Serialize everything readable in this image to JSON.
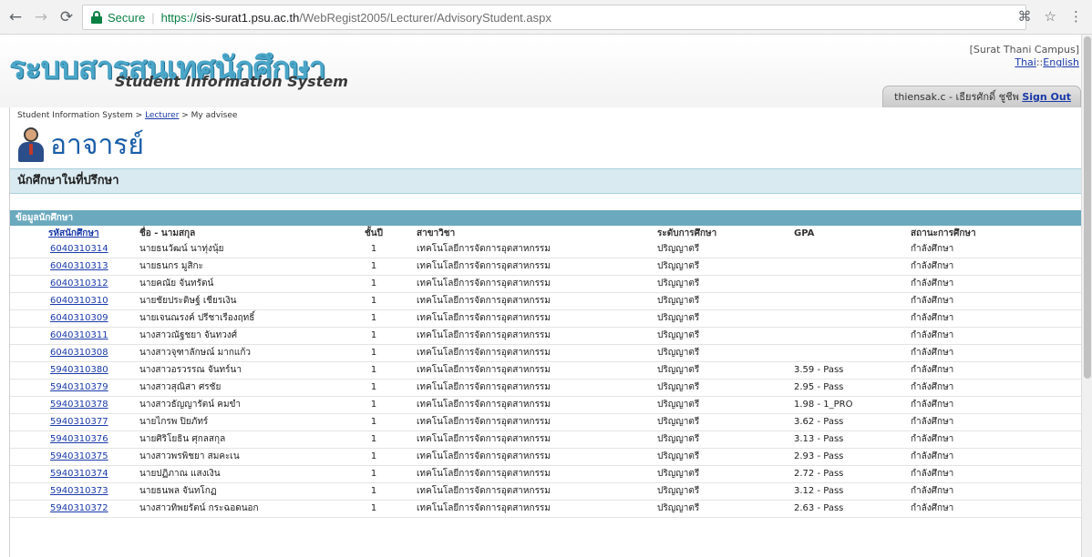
{
  "browser": {
    "secure_label": "Secure",
    "url_scheme": "https://",
    "url_host": "sis-surat1.psu.ac.th",
    "url_path": "/WebRegist2005/Lecturer/AdvisoryStudent.aspx"
  },
  "header": {
    "logo_thai": "ระบบสารสนเทศนักศึกษา",
    "logo_eng": "Student Information System",
    "campus": "[Surat Thani Campus]",
    "lang_thai": "Thai",
    "lang_sep": "::",
    "lang_eng": "English",
    "user": "thiensak.c - เธียรศักดิ์ ชูชีพ",
    "signout": "Sign Out"
  },
  "breadcrumb": {
    "root": "Student Information System",
    "sep1": " > ",
    "lecturer": "Lecturer",
    "sep2": " > ",
    "current": "My advisee"
  },
  "page": {
    "title": "อาจารย์",
    "section": "นักศึกษาในที่ปรึกษา",
    "data_head": "ข้อมูลนักศึกษา"
  },
  "table": {
    "columns": [
      "รหัสนักศึกษา",
      "ชื่อ - นามสกุล",
      "ชั้นปี",
      "สาขาวิชา",
      "ระดับการศึกษา",
      "GPA",
      "สถานะการศึกษา"
    ],
    "rows": [
      [
        "6040310314",
        "นายธนวัฒน์ นาทุ่งนุ้ย",
        "1",
        "เทคโนโลยีการจัดการอุตสาหกรรม",
        "ปริญญาตรี",
        "",
        "กำลังศึกษา"
      ],
      [
        "6040310313",
        "นายธนกร มูสิกะ",
        "1",
        "เทคโนโลยีการจัดการอุตสาหกรรม",
        "ปริญญาตรี",
        "",
        "กำลังศึกษา"
      ],
      [
        "6040310312",
        "นายคณัย จันทรัตน์",
        "1",
        "เทคโนโลยีการจัดการอุตสาหกรรม",
        "ปริญญาตรี",
        "",
        "กำลังศึกษา"
      ],
      [
        "6040310310",
        "นายชัยประดิษฐ์ เชียรเงิน",
        "1",
        "เทคโนโลยีการจัดการอุตสาหกรรม",
        "ปริญญาตรี",
        "",
        "กำลังศึกษา"
      ],
      [
        "6040310309",
        "นายเจนณรงค์ ปรีชาเรืองฤทธิ์",
        "1",
        "เทคโนโลยีการจัดการอุตสาหกรรม",
        "ปริญญาตรี",
        "",
        "กำลังศึกษา"
      ],
      [
        "6040310311",
        "นางสาวณัฐชยา จันทวงศ์",
        "1",
        "เทคโนโลยีการจัดการอุตสาหกรรม",
        "ปริญญาตรี",
        "",
        "กำลังศึกษา"
      ],
      [
        "6040310308",
        "นางสาวจุฑาลักษณ์ มากแก้ว",
        "1",
        "เทคโนโลยีการจัดการอุตสาหกรรม",
        "ปริญญาตรี",
        "",
        "กำลังศึกษา"
      ],
      [
        "5940310380",
        "นางสาวอรวรรณ จันทร์นา",
        "1",
        "เทคโนโลยีการจัดการอุตสาหกรรม",
        "ปริญญาตรี",
        "3.59 - Pass",
        "กำลังศึกษา"
      ],
      [
        "5940310379",
        "นางสาวสุณิสา ศรชัย",
        "1",
        "เทคโนโลยีการจัดการอุตสาหกรรม",
        "ปริญญาตรี",
        "2.95 - Pass",
        "กำลังศึกษา"
      ],
      [
        "5940310378",
        "นางสาวธัญญารัตน์ คมขำ",
        "1",
        "เทคโนโลยีการจัดการอุตสาหกรรม",
        "ปริญญาตรี",
        "1.98 - 1_PRO",
        "กำลังศึกษา"
      ],
      [
        "5940310377",
        "นายไกรพ ปิยภัทร์",
        "1",
        "เทคโนโลยีการจัดการอุตสาหกรรม",
        "ปริญญาตรี",
        "3.62 - Pass",
        "กำลังศึกษา"
      ],
      [
        "5940310376",
        "นายศิริโยธิน ศุกลสกุล",
        "1",
        "เทคโนโลยีการจัดการอุตสาหกรรม",
        "ปริญญาตรี",
        "3.13 - Pass",
        "กำลังศึกษา"
      ],
      [
        "5940310375",
        "นางสาวพรพิชยา สมคะเน",
        "1",
        "เทคโนโลยีการจัดการอุตสาหกรรม",
        "ปริญญาตรี",
        "2.93 - Pass",
        "กำลังศึกษา"
      ],
      [
        "5940310374",
        "นายปฏิภาณ แสงเงิน",
        "1",
        "เทคโนโลยีการจัดการอุตสาหกรรม",
        "ปริญญาตรี",
        "2.72 - Pass",
        "กำลังศึกษา"
      ],
      [
        "5940310373",
        "นายธนพล จันทโกฏ",
        "1",
        "เทคโนโลยีการจัดการอุตสาหกรรม",
        "ปริญญาตรี",
        "3.12 - Pass",
        "กำลังศึกษา"
      ],
      [
        "5940310372",
        "นางสาวทิพยรัตน์ กระฉอดนอก",
        "1",
        "เทคโนโลยีการจัดการอุตสาหกรรม",
        "ปริญญาตรี",
        "2.63 - Pass",
        "กำลังศึกษา"
      ]
    ]
  }
}
